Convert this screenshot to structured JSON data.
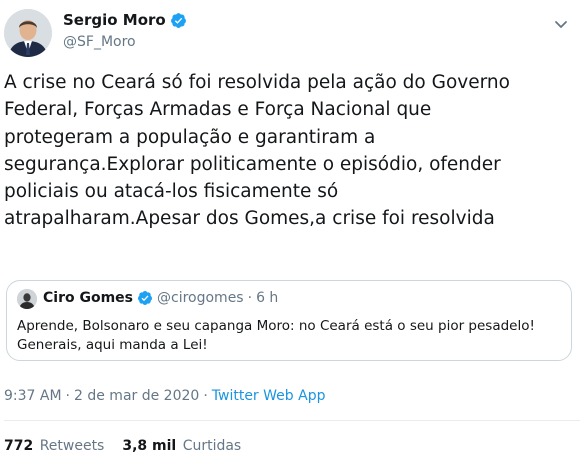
{
  "author": {
    "name": "Sergio Moro",
    "handle": "@SF_Moro",
    "verified": true,
    "avatar_icon": "person-avatar"
  },
  "tweet": {
    "text": "A crise no Ceará só foi resolvida pela ação do Governo\nFederal, Forças Armadas e Força Nacional que\nprotegeram a população e garantiram a\nsegurança.Explorar politicamente o episódio, ofender\npoliciais ou atacá-los fisicamente só\natrapalharam.Apesar dos Gomes,a crise foi resolvida"
  },
  "quoted_tweet": {
    "name": "Ciro Gomes",
    "handle": "@cirogomes",
    "separator": "·",
    "time": "6 h",
    "verified": true,
    "text": "Aprende, Bolsonaro e seu capanga Moro: no Ceará está o seu pior pesadelo!\nGenerais, aqui manda a Lei!"
  },
  "meta": {
    "time": "9:37 AM",
    "separator": "·",
    "date": "2 de mar de 2020",
    "separator2": "·",
    "source": "Twitter Web App"
  },
  "stats": {
    "retweets_count": "772",
    "retweets_label": "Retweets",
    "likes_count": "3,8 mil",
    "likes_label": "Curtidas"
  },
  "colors": {
    "link": "#1b95e0",
    "verified": "#1da1f2",
    "secondary_text": "#657786",
    "border": "#ccd6dd"
  }
}
